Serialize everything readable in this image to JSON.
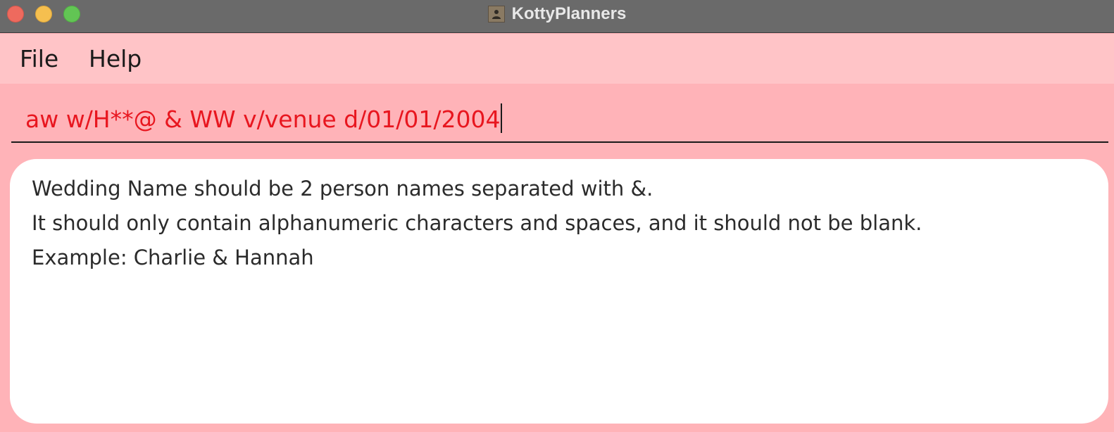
{
  "window": {
    "title": "KottyPlanners"
  },
  "menubar": {
    "items": [
      {
        "label": "File"
      },
      {
        "label": "Help"
      }
    ]
  },
  "command": {
    "text": "aw w/H**@ & WW v/venue d/01/01/2004",
    "text_color": "#e8161f"
  },
  "result": {
    "lines": [
      "Wedding Name should be 2 person names separated with &.",
      "It should only contain alphanumeric characters and spaces, and it should not be blank.",
      "Example: Charlie & Hannah"
    ]
  },
  "icons": {
    "app": "person-portrait-icon",
    "close": "close-window-icon",
    "minimize": "minimize-window-icon",
    "maximize": "maximize-window-icon"
  },
  "colors": {
    "background": "#ffb3b8",
    "menubar": "#ffc4c7",
    "titlebar": "#6a6a6a",
    "panel": "#ffffff"
  }
}
